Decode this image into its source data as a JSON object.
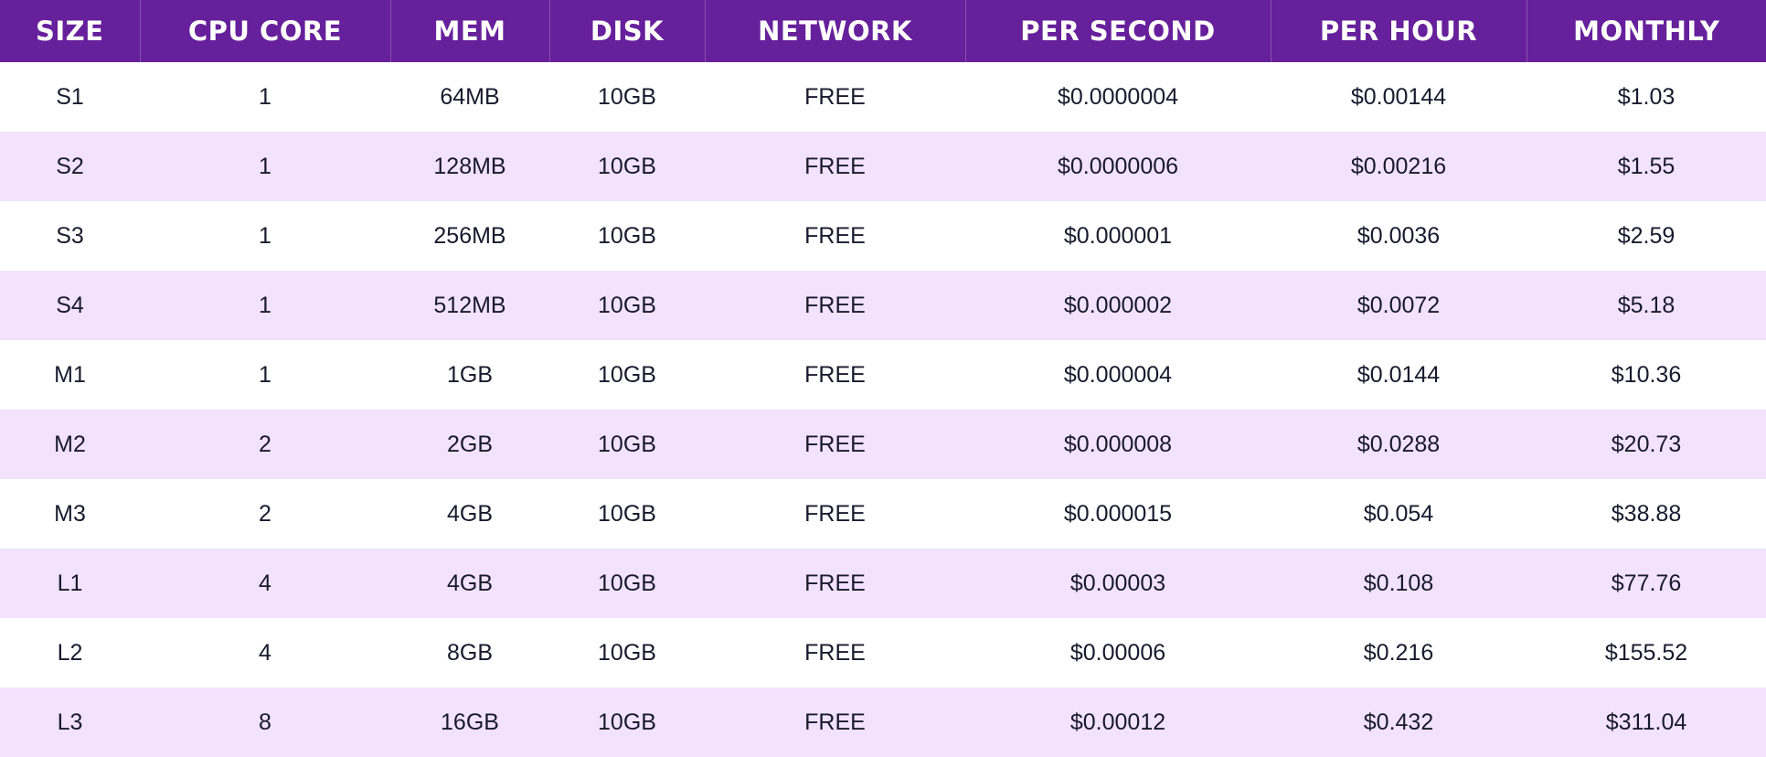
{
  "pricing_table": {
    "columns": [
      "SIZE",
      "CPU CORE",
      "MEM",
      "DISK",
      "NETWORK",
      "PER SECOND",
      "PER HOUR",
      "MONTHLY"
    ],
    "rows": [
      [
        "S1",
        "1",
        "64MB",
        "10GB",
        "FREE",
        "$0.0000004",
        "$0.00144",
        "$1.03"
      ],
      [
        "S2",
        "1",
        "128MB",
        "10GB",
        "FREE",
        "$0.0000006",
        "$0.00216",
        "$1.55"
      ],
      [
        "S3",
        "1",
        "256MB",
        "10GB",
        "FREE",
        "$0.000001",
        "$0.0036",
        "$2.59"
      ],
      [
        "S4",
        "1",
        "512MB",
        "10GB",
        "FREE",
        "$0.000002",
        "$0.0072",
        "$5.18"
      ],
      [
        "M1",
        "1",
        "1GB",
        "10GB",
        "FREE",
        "$0.000004",
        "$0.0144",
        "$10.36"
      ],
      [
        "M2",
        "2",
        "2GB",
        "10GB",
        "FREE",
        "$0.000008",
        "$0.0288",
        "$20.73"
      ],
      [
        "M3",
        "2",
        "4GB",
        "10GB",
        "FREE",
        "$0.000015",
        "$0.054",
        "$38.88"
      ],
      [
        "L1",
        "4",
        "4GB",
        "10GB",
        "FREE",
        "$0.00003",
        "$0.108",
        "$77.76"
      ],
      [
        "L2",
        "4",
        "8GB",
        "10GB",
        "FREE",
        "$0.00006",
        "$0.216",
        "$155.52"
      ],
      [
        "L3",
        "8",
        "16GB",
        "10GB",
        "FREE",
        "$0.00012",
        "$0.432",
        "$311.04"
      ]
    ]
  },
  "colors": {
    "header_bg": "#66209b",
    "header_text": "#ffffff",
    "stripe_row": "#f2e2fc",
    "body_text": "#1a1a2e"
  }
}
